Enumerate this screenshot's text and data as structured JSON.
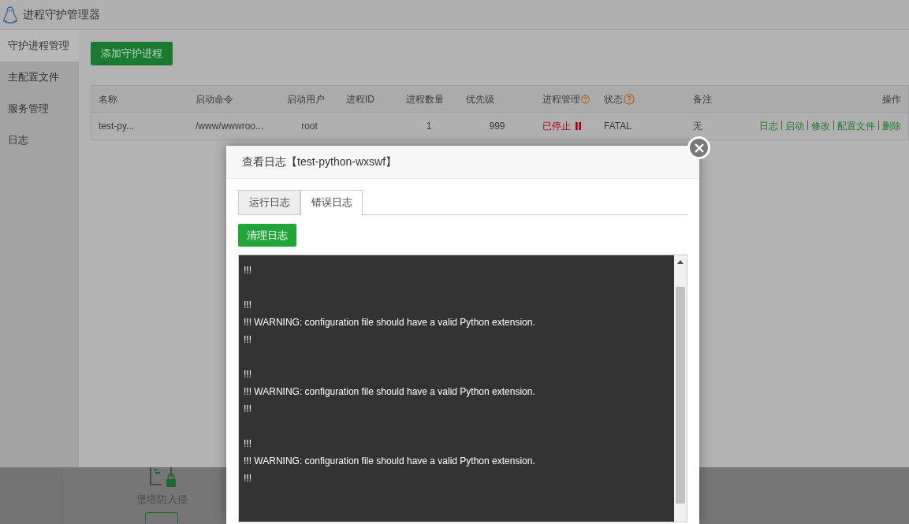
{
  "app": {
    "title": "进程守护管理器"
  },
  "sidebar": {
    "items": [
      {
        "label": "守护进程管理",
        "selected": true
      },
      {
        "label": "主配置文件",
        "selected": false
      },
      {
        "label": "服务管理",
        "selected": false
      },
      {
        "label": "日志",
        "selected": false
      }
    ]
  },
  "add_button": "添加守护进程",
  "table": {
    "columns": [
      {
        "label": "名称",
        "help": false
      },
      {
        "label": "启动命令",
        "help": false
      },
      {
        "label": "启动用户",
        "help": false
      },
      {
        "label": "进程ID",
        "help": false
      },
      {
        "label": "进程数量",
        "help": false
      },
      {
        "label": "优先级",
        "help": false
      },
      {
        "label": "进程管理",
        "help": true
      },
      {
        "label": "状态",
        "help": true
      },
      {
        "label": "备注",
        "help": false
      },
      {
        "label": "操作",
        "help": false
      }
    ],
    "rows": [
      {
        "name": "test-py...",
        "command": "/www/wwwroo...",
        "user": "root",
        "count": "1",
        "priority": "999",
        "manage": "已停止",
        "running": false,
        "status": "FATAL",
        "note": "无",
        "actions": [
          "日志",
          "启动",
          "修改",
          "配置文件",
          "删除"
        ]
      }
    ]
  },
  "background_page": {
    "feature_label": "堡塔防入侵"
  },
  "modal": {
    "title": "查看日志【test-python-wxswf】",
    "tabs": [
      {
        "label": "运行日志",
        "selected": false
      },
      {
        "label": "错误日志",
        "selected": true
      }
    ],
    "clear_button": "清理日志",
    "log_blocks": [
      [
        "!!!"
      ],
      [
        "!!!",
        "!!! WARNING: configuration file should have a valid Python extension.",
        "!!!"
      ],
      [
        "!!!",
        "!!! WARNING: configuration file should have a valid Python extension.",
        "!!!"
      ],
      [
        "!!!",
        "!!! WARNING: configuration file should have a valid Python extension.",
        "!!!"
      ]
    ]
  }
}
